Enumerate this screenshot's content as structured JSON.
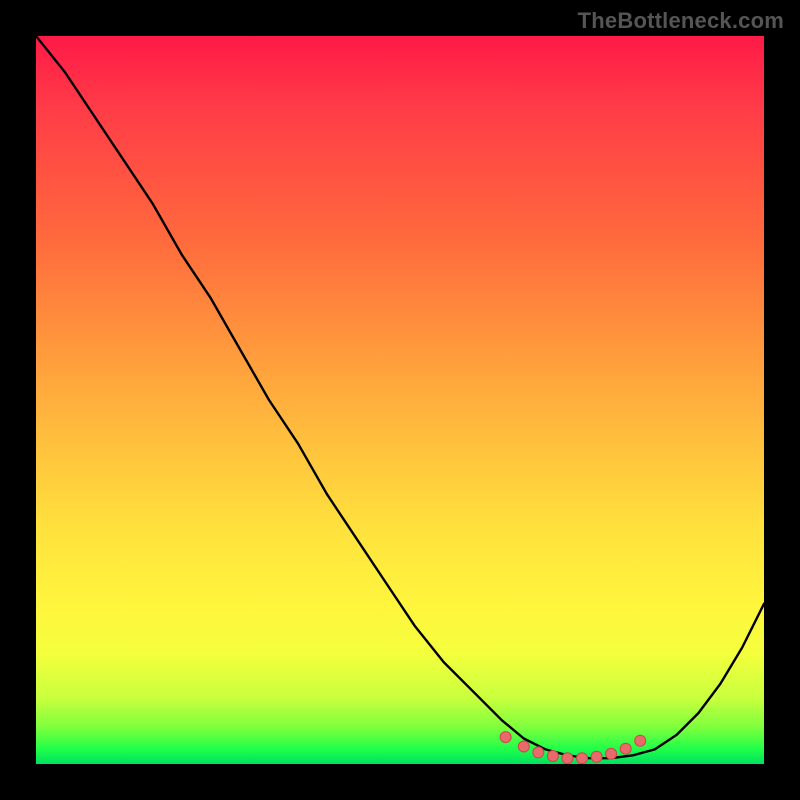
{
  "watermark": "TheBottleneck.com",
  "colors": {
    "background": "#000000",
    "curve_stroke": "#000000",
    "dot_fill": "#e96a6a",
    "dot_stroke": "#c74a4a"
  },
  "chart_data": {
    "type": "line",
    "title": "",
    "xlabel": "",
    "ylabel": "",
    "xlim": [
      0,
      100
    ],
    "ylim": [
      0,
      100
    ],
    "series": [
      {
        "name": "bottleneck-curve",
        "x": [
          0,
          4,
          8,
          12,
          16,
          20,
          24,
          28,
          32,
          36,
          40,
          44,
          48,
          52,
          56,
          60,
          64,
          67,
          70,
          73,
          76,
          79,
          82,
          85,
          88,
          91,
          94,
          97,
          100
        ],
        "y_percent_from_top": [
          0,
          5,
          11,
          17,
          23,
          30,
          36,
          43,
          50,
          56,
          63,
          69,
          75,
          81,
          86,
          90,
          94,
          96.5,
          98,
          98.8,
          99.2,
          99.2,
          98.8,
          98,
          96,
          93,
          89,
          84,
          78
        ]
      }
    ],
    "markers": {
      "name": "valley-dots",
      "x": [
        64.5,
        67,
        69,
        71,
        73,
        75,
        77,
        79,
        81,
        83
      ],
      "y_percent_from_top": [
        96.3,
        97.6,
        98.4,
        98.9,
        99.2,
        99.2,
        99.0,
        98.6,
        97.9,
        96.8
      ]
    },
    "gradient_stops": [
      {
        "pos": 0,
        "color": "#ff1a47"
      },
      {
        "pos": 28,
        "color": "#ff6a3d"
      },
      {
        "pos": 56,
        "color": "#ffc13d"
      },
      {
        "pos": 78,
        "color": "#fff53d"
      },
      {
        "pos": 95,
        "color": "#7dff3d"
      },
      {
        "pos": 100,
        "color": "#00e060"
      }
    ]
  }
}
